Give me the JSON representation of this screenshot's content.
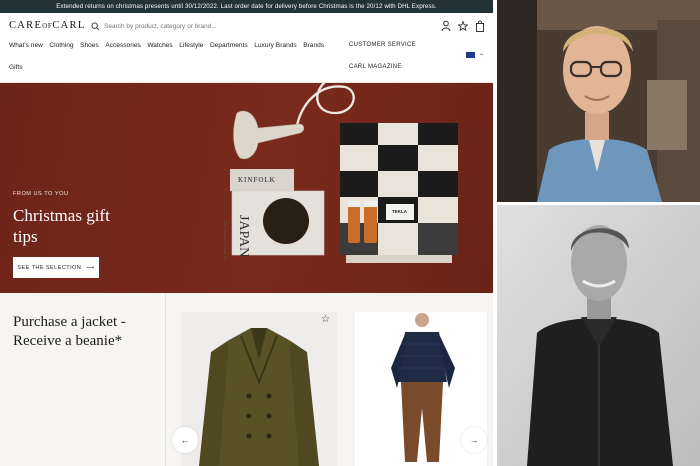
{
  "banner": {
    "text": "Extended returns on christmas presents until 30/12/2022. Last order date for delivery before Christmas is the 20/12 with DHL Express."
  },
  "header": {
    "logo_main": "CARE",
    "logo_of": "OF",
    "logo_end": "CARL",
    "search_placeholder": "Search by product, category or brand..."
  },
  "nav": {
    "items": [
      "What's new",
      "Clothing",
      "Shoes",
      "Accessories",
      "Watches",
      "Lifestyle",
      "Departments",
      "Luxury Brands",
      "Brands"
    ],
    "gifts": "Gifts",
    "customer_service": "CUSTOMER SERVICE",
    "magazine": "CARL MAGAZINE"
  },
  "hero": {
    "eyebrow": "FROM US TO YOU",
    "title": "Christmas gift tips",
    "cta": "SEE THE SELECTION",
    "book_title": "KINFOLK",
    "book_subtitle": "JAPAN",
    "book_side": "The Monocle Book of",
    "tag": "TEKLA"
  },
  "promo": {
    "title": "Purchase a jacket - Receive a beanie*"
  },
  "colors": {
    "banner": "#223237",
    "hero": "#7a2a1c"
  },
  "icons": [
    "search-icon",
    "user-icon",
    "star-icon",
    "bag-icon",
    "flag-icon",
    "chevron-down-icon",
    "arrow-right-icon",
    "arrow-left-icon"
  ]
}
